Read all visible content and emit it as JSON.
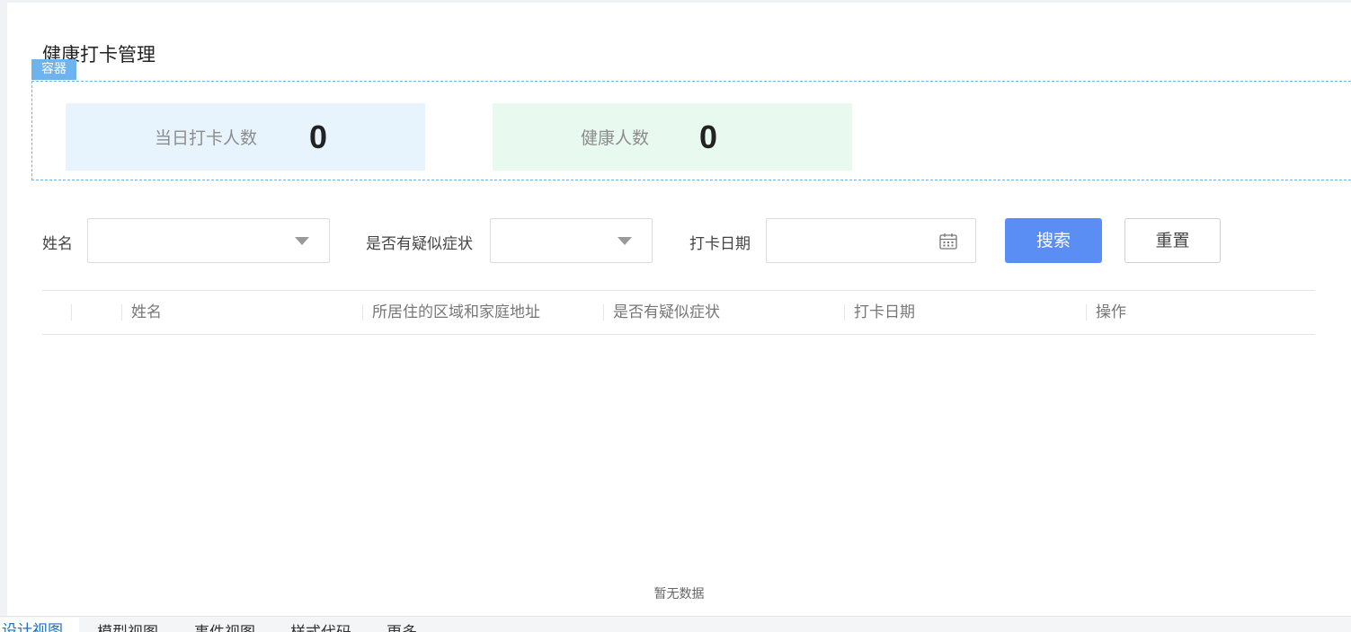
{
  "page": {
    "title": "健康打卡管理",
    "container_tag": "容器"
  },
  "stats": {
    "checkin_label": "当日打卡人数",
    "checkin_value": "0",
    "healthy_label": "健康人数",
    "healthy_value": "0"
  },
  "filters": {
    "name_label": "姓名",
    "name_value": "",
    "symptom_label": "是否有疑似症状",
    "symptom_value": "",
    "date_label": "打卡日期",
    "date_value": "",
    "search_label": "搜索",
    "reset_label": "重置"
  },
  "table": {
    "columns": [
      "姓名",
      "所居住的区域和家庭地址",
      "是否有疑似症状",
      "打卡日期",
      "操作"
    ],
    "rows": [],
    "empty_text": "暂无数据"
  },
  "bottom_tabs": [
    "设计视图",
    "模型视图",
    "事件视图",
    "样式代码",
    "更多"
  ],
  "colors": {
    "primary": "#5b8ef4",
    "container": "#6fb3ec",
    "stat_blue": "#e8f4fd",
    "stat_green": "#e8f9ef"
  }
}
